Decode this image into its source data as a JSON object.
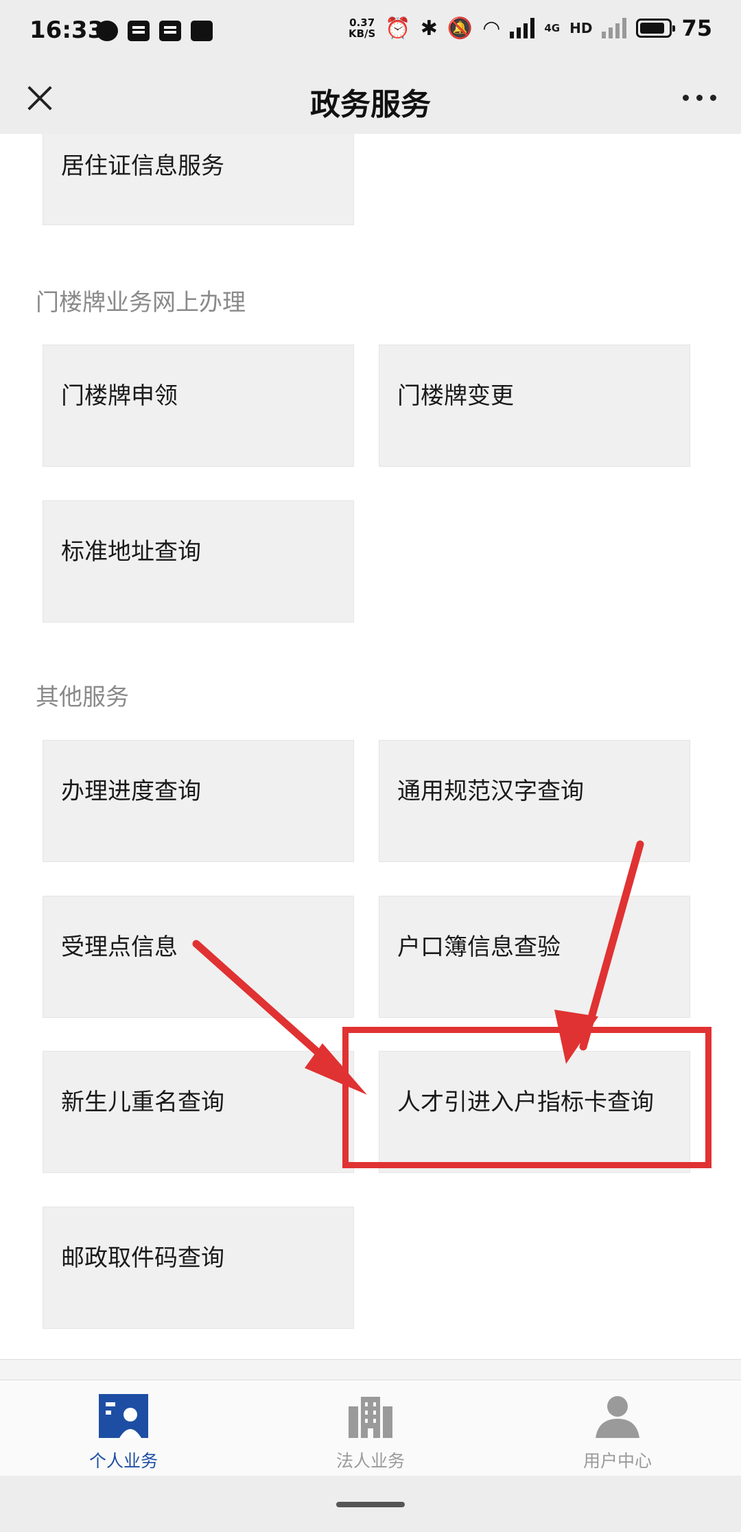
{
  "status_bar": {
    "time": "16:33",
    "net_speed_value": "0.37",
    "net_speed_unit": "KB/S",
    "net_type": "4G",
    "hd_label": "HD",
    "battery": "75"
  },
  "header": {
    "title": "政务服务"
  },
  "tiles_top": {
    "residence_permit": "居住证信息服务"
  },
  "sections": {
    "door_plate": {
      "title": "门楼牌业务网上办理",
      "items": [
        "门楼牌申领",
        "门楼牌变更",
        "标准地址查询"
      ]
    },
    "other": {
      "title": "其他服务",
      "items": [
        "办理进度查询",
        "通用规范汉字查询",
        "受理点信息",
        "户口簿信息查验",
        "新生儿重名查询",
        "人才引进入户指标卡查询",
        "邮政取件码查询"
      ]
    }
  },
  "annotation": {
    "color": "#e03232"
  },
  "bottom_nav": {
    "items": [
      {
        "label": "个人业务",
        "icon": "personal-business-icon",
        "active": true
      },
      {
        "label": "法人业务",
        "icon": "building-icon",
        "active": false
      },
      {
        "label": "用户中心",
        "icon": "user-icon",
        "active": false
      }
    ],
    "active_color": "#1d4ea3",
    "inactive_color": "#9a9a9a"
  }
}
